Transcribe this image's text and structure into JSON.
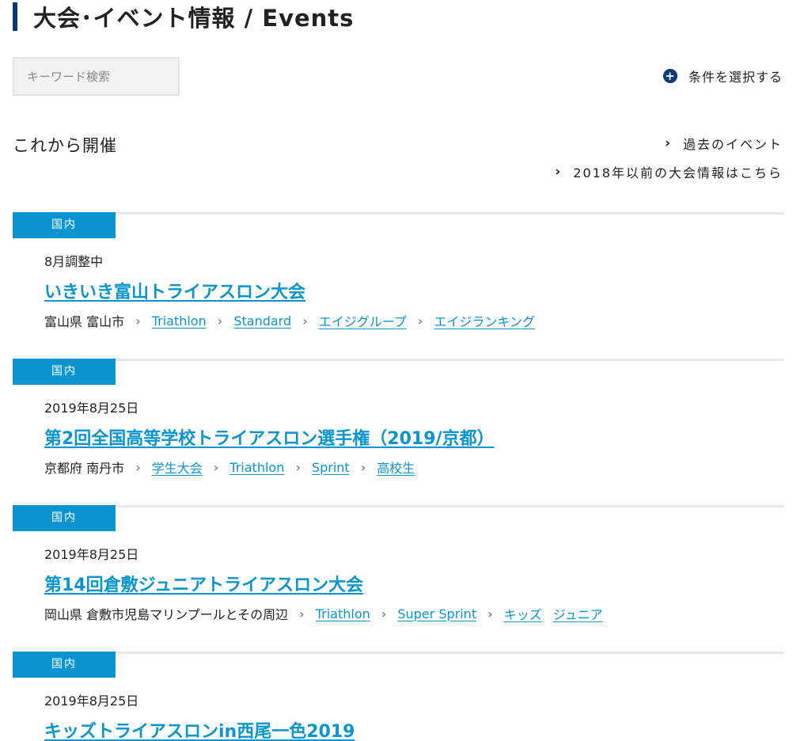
{
  "header": {
    "title": "大会･イベント情報 / Events"
  },
  "search": {
    "placeholder": "キーワード検索",
    "value": ""
  },
  "filter": {
    "label": "条件を選択する",
    "icon": "plus-circle-icon"
  },
  "section": {
    "heading": "これから開催"
  },
  "links": {
    "past_events": "過去のイベント",
    "before_2018": "2018年以前の大会情報はこちら"
  },
  "colors": {
    "accent": "#0a95d0",
    "header_bar": "#0a3a7a",
    "divider": "#e8e8e8"
  },
  "events": [
    {
      "badge": "国内",
      "date": "8月調整中",
      "title": "いきいき富山トライアスロン大会",
      "location": "富山県 富山市",
      "tags": [
        "Triathlon",
        "Standard",
        "エイジグループ",
        "エイジランキング"
      ]
    },
    {
      "badge": "国内",
      "date": "2019年8月25日",
      "title": "第2回全国高等学校トライアスロン選手権（2019/京都）",
      "location": "京都府 南丹市",
      "tags": [
        "学生大会",
        "Triathlon",
        "Sprint",
        "高校生"
      ]
    },
    {
      "badge": "国内",
      "date": "2019年8月25日",
      "title": "第14回倉敷ジュニアトライアスロン大会",
      "location": "岡山県 倉敷市児島マリンプールとその周辺",
      "tags": [
        "Triathlon",
        "Super Sprint",
        "キッズ",
        "ジュニア"
      ]
    },
    {
      "badge": "国内",
      "date": "2019年8月25日",
      "title": "キッズトライアスロンin西尾一色2019"
    }
  ]
}
